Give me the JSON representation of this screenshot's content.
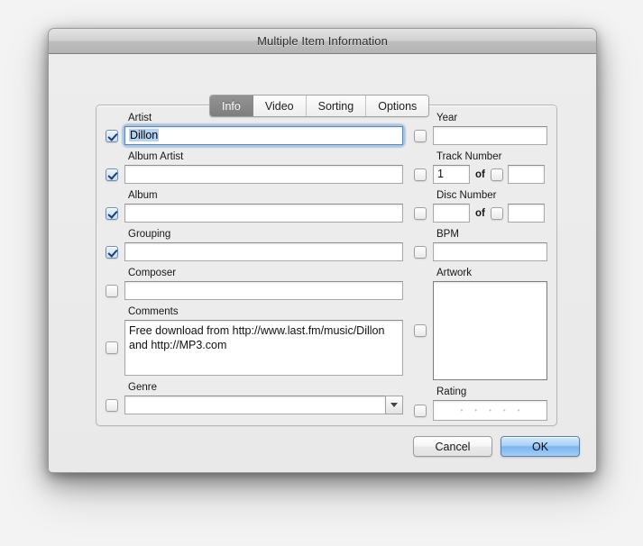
{
  "window": {
    "title": "Multiple Item Information"
  },
  "tabs": [
    {
      "label": "Info",
      "active": true
    },
    {
      "label": "Video",
      "active": false
    },
    {
      "label": "Sorting",
      "active": false
    },
    {
      "label": "Options",
      "active": false
    }
  ],
  "left_fields": {
    "artist": {
      "label": "Artist",
      "value": "Dillon",
      "checked": true,
      "focused": true
    },
    "album_artist": {
      "label": "Album Artist",
      "value": "",
      "checked": true
    },
    "album": {
      "label": "Album",
      "value": "",
      "checked": true
    },
    "grouping": {
      "label": "Grouping",
      "value": "",
      "checked": true
    },
    "composer": {
      "label": "Composer",
      "value": "",
      "checked": false
    },
    "comments": {
      "label": "Comments",
      "value": "Free download from http://www.last.fm/music/Dillon and http://MP3.com",
      "checked": false
    },
    "genre": {
      "label": "Genre",
      "value": "",
      "checked": false,
      "icon": "chevron-down-icon"
    }
  },
  "right_fields": {
    "year": {
      "label": "Year",
      "value": "",
      "checked": false
    },
    "track_number": {
      "label": "Track Number",
      "value": "1",
      "of_label": "of",
      "total": "",
      "checked": false,
      "total_checked": false
    },
    "disc_number": {
      "label": "Disc Number",
      "value": "",
      "of_label": "of",
      "total": "",
      "checked": false,
      "total_checked": false
    },
    "bpm": {
      "label": "BPM",
      "value": "",
      "checked": false
    },
    "artwork": {
      "label": "Artwork",
      "checked": false
    },
    "rating": {
      "label": "Rating",
      "checked": false,
      "stars": 5,
      "star_glyph": "•"
    }
  },
  "buttons": {
    "cancel": "Cancel",
    "ok": "OK"
  },
  "colors": {
    "accent": "#7ab5ef",
    "selection": "#b6d4f2",
    "checkmark": "#1b3f6e"
  }
}
